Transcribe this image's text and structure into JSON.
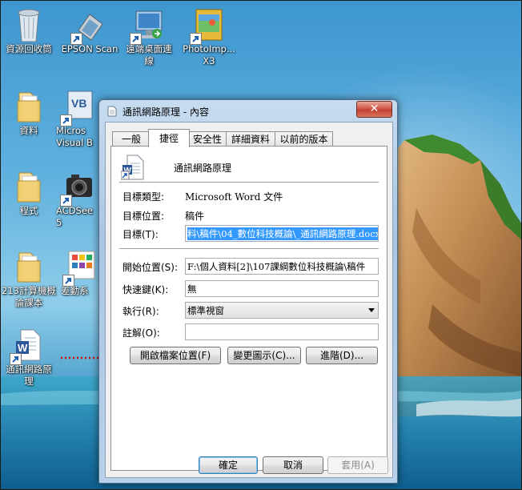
{
  "desktop": {
    "icons": [
      {
        "label": "資源回收筒",
        "icon": "recycle-bin-icon"
      },
      {
        "label": "EPSON Scan",
        "icon": "epson-scan-icon"
      },
      {
        "label": "遠端桌面連\n線",
        "icon": "remote-desktop-icon"
      },
      {
        "label": "PhotoImp...\nX3",
        "icon": "photoimpact-icon"
      },
      {
        "label": "資料",
        "icon": "folder-icon"
      },
      {
        "label": "Micros\nVisual B",
        "icon": "visual-basic-icon"
      },
      {
        "label": "程式",
        "icon": "folder-icon"
      },
      {
        "label": "ACDSee\n5",
        "icon": "acdsee-icon"
      },
      {
        "label": "213計算機概\n論課本",
        "icon": "folder-icon"
      },
      {
        "label": "差勤系",
        "icon": "app-grid-icon"
      },
      {
        "label": "通訊網路原\n理",
        "icon": "word-document-shortcut-icon"
      }
    ],
    "annotation_color": "#d40000"
  },
  "dialog": {
    "title": "通訊網路原理 - 內容",
    "close_glyph": "✕",
    "tabs": [
      "一般",
      "捷徑",
      "安全性",
      "詳細資料",
      "以前的版本"
    ],
    "active_tab": "捷徑",
    "file_name": "通訊網路原理",
    "fields": {
      "target_type_label": "目標類型:",
      "target_type_value": "Microsoft Word 文件",
      "target_location_label": "目標位置:",
      "target_location_value": "稿件",
      "target_label": "目標(T):",
      "target_value": "料\\稿件\\04_數位科技概論\\_通訊網路原理.docx",
      "start_in_label": "開始位置(S):",
      "start_in_value": "F:\\個人資料[2]\\107課綱數位科技概論\\稿件",
      "shortcut_key_label": "快速鍵(K):",
      "shortcut_key_value": "無",
      "run_label": "執行(R):",
      "run_value": "標準視窗",
      "comment_label": "註解(O):",
      "comment_value": ""
    },
    "buttons": {
      "open_file_location": "開啟檔案位置(F)",
      "change_icon": "變更圖示(C)...",
      "advanced": "進階(D)...",
      "ok": "確定",
      "cancel": "取消",
      "apply": "套用(A)"
    }
  }
}
